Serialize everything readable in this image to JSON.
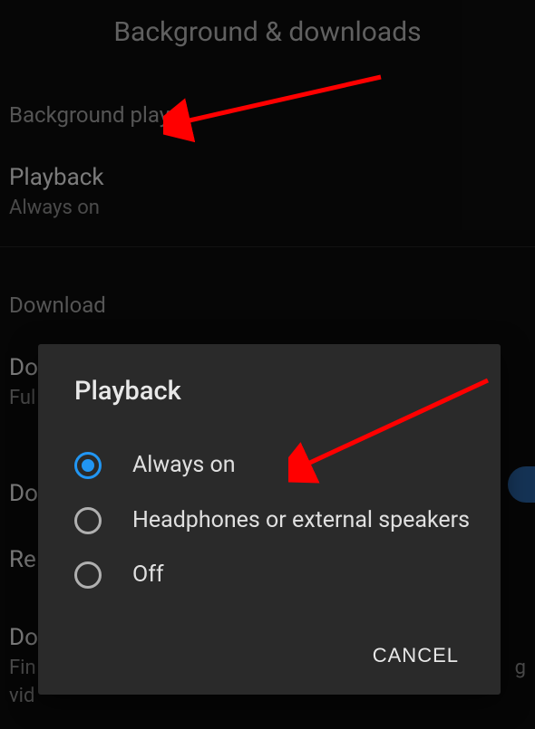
{
  "page": {
    "title": "Background & downloads"
  },
  "sections": {
    "backgroundPlay": {
      "header": "Background play",
      "playback": {
        "label": "Playback",
        "value": "Always on"
      }
    },
    "download": {
      "header": "Download",
      "item1": {
        "labelPrefix": "Do",
        "subPrefix": "Ful"
      },
      "item2": {
        "labelPrefix": "Do"
      },
      "item3": {
        "labelPrefix": "Re"
      },
      "item4": {
        "labelPrefix": "Do",
        "sub1": "Fin",
        "sub2": "vid",
        "sub1suffix": "g"
      }
    }
  },
  "dialog": {
    "title": "Playback",
    "options": [
      {
        "label": "Always on",
        "selected": true
      },
      {
        "label": "Headphones or external speakers",
        "selected": false
      },
      {
        "label": "Off",
        "selected": false
      }
    ],
    "cancel": "CANCEL"
  }
}
